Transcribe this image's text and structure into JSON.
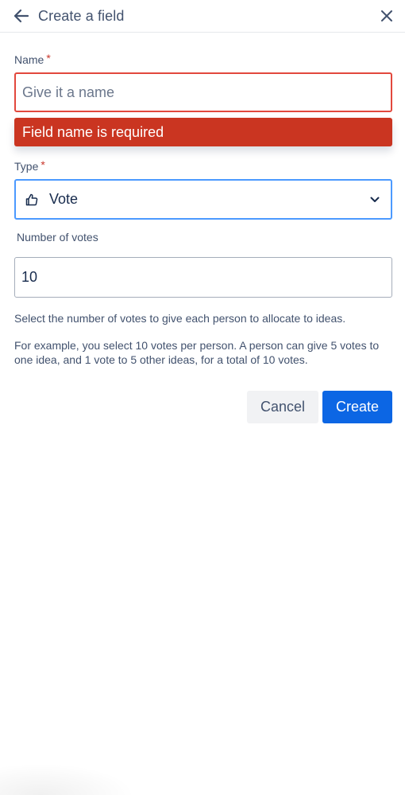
{
  "header": {
    "title": "Create a field",
    "back_icon": "arrow-left-icon",
    "close_icon": "close-icon"
  },
  "form": {
    "name": {
      "label": "Name",
      "required_marker": "*",
      "placeholder": "Give it a name",
      "value": "",
      "error": "Field name is required"
    },
    "type": {
      "label": "Type",
      "required_marker": "*",
      "selected": "Vote",
      "icon": "thumbs-up-icon",
      "chevron_icon": "chevron-down-icon"
    },
    "votes": {
      "label": "Number of votes",
      "value": "10"
    },
    "help_text_1": "Select the number of votes to give each person to allocate to ideas.",
    "help_text_2": "For example, you select 10 votes per person. A person can give 5 votes to one idea, and 1 vote to 5 other ideas, for a total of 10 votes."
  },
  "actions": {
    "cancel_label": "Cancel",
    "create_label": "Create"
  },
  "colors": {
    "error": "#ca3521",
    "error_border": "#e2483d",
    "focus_border": "#4c9aff",
    "primary": "#0c66e4",
    "required": "#c9372c"
  }
}
